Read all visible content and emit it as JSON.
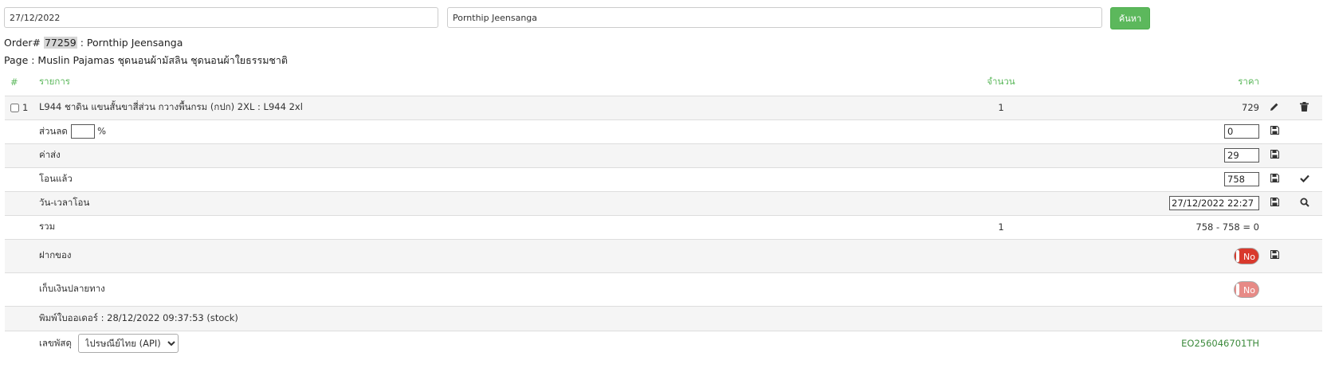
{
  "search": {
    "date_value": "27/12/2022",
    "name_value": "Pornthip Jeensanga",
    "button_label": "ค้นหา"
  },
  "order": {
    "label": "Order#",
    "number": "77259",
    "customer": ": Pornthip Jeensanga",
    "page_line": "Page : Muslin Pajamas ชุดนอนผ้ามัสลิน ชุดนอนผ้าใยธรรมชาติ"
  },
  "table": {
    "headers": {
      "num": "#",
      "item": "รายการ",
      "qty": "จำนวน",
      "price": "ราคา"
    },
    "item_row": {
      "index": "1",
      "name": "L944 ชาดิน แขนสั้นขาสี่ส่วน กวางพื้นกรม (กปก) 2XL : L944 2xl",
      "qty": "1",
      "price": "729"
    },
    "discount": {
      "label": "ส่วนลด",
      "unit": "%",
      "value": "0"
    },
    "shipping": {
      "label": "ค่าส่ง",
      "value": "29"
    },
    "transferred": {
      "label": "โอนแล้ว",
      "value": "758"
    },
    "transfer_time": {
      "label": "วัน-เวลาโอน",
      "value": "27/12/2022 22:27"
    },
    "total": {
      "label": "รวม",
      "qty": "1",
      "formula": "758 - 758 = 0"
    },
    "deposit": {
      "label": "ฝากของ",
      "toggle": "No"
    },
    "cod": {
      "label": "เก็บเงินปลายทาง",
      "toggle": "No"
    },
    "printed": {
      "text": "พิมพ์ใบออเดอร์ : 28/12/2022 09:37:53 (stock)"
    },
    "parcel": {
      "label": "เลขพัสดุ",
      "carrier_selected": "ไปรษณีย์ไทย (API)",
      "tracking": "EO256046701TH"
    }
  },
  "colors": {
    "accent_green": "#5cb85c",
    "toggle_red": "#d9392c",
    "tracking_green": "#3c8a3c"
  }
}
